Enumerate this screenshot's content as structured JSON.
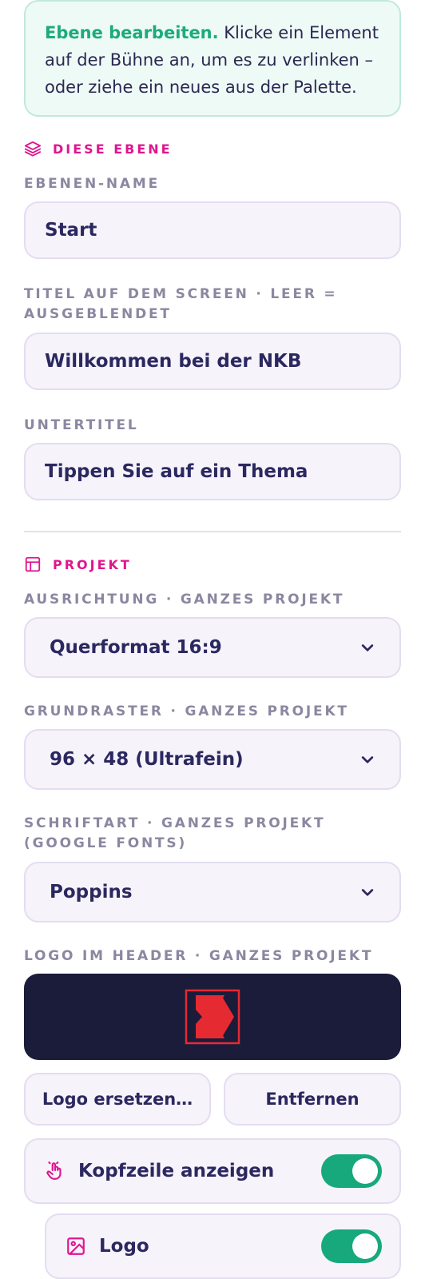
{
  "info": {
    "accent": "Ebene bearbeiten.",
    "text": " Klicke ein Element auf der Bühne an, um es zu verlinken – oder ziehe ein neues aus der Palette."
  },
  "layer_section": {
    "title": "DIESE EBENE",
    "icon": "layers-icon",
    "name_label": "EBENEN-NAME",
    "name_value": "Start",
    "title_label": "TITEL AUF DEM SCREEN · LEER = AUSGEBLENDET",
    "title_value": "Willkommen bei der NKB",
    "subtitle_label": "UNTERTITEL",
    "subtitle_value": "Tippen Sie auf ein Thema"
  },
  "project_section": {
    "title": "PROJEKT",
    "icon": "layout-icon",
    "orientation_label": "AUSRICHTUNG · GANZES PROJEKT",
    "orientation_value": "Querformat 16:9",
    "grid_label": "GRUNDRASTER · GANZES PROJEKT",
    "grid_value": "96 × 48 (Ultrafein)",
    "font_label": "SCHRIFTART · GANZES PROJEKT (GOOGLE FONTS)",
    "font_value": "Poppins",
    "logo_label": "LOGO IM HEADER · GANZES PROJEKT",
    "replace_logo": "Logo ersetzen…",
    "remove_logo": "Entfernen",
    "header_toggle_label": "Kopfzeile anzeigen",
    "header_toggle_on": true,
    "logo_toggle_label": "Logo",
    "logo_toggle_on": true
  },
  "colors": {
    "accent_pink": "#e0158f",
    "accent_green": "#17a97b",
    "logo_bg": "#1b1b3a",
    "logo_red": "#e52a32"
  }
}
